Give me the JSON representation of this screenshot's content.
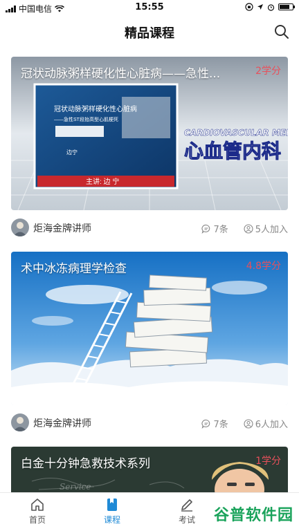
{
  "status": {
    "carrier": "中国电信",
    "time": "15:55"
  },
  "header": {
    "title": "精品课程"
  },
  "courses": [
    {
      "title": "冠状动脉粥样硬化性心脏病——急性...",
      "credit": "2学分",
      "teacher": "炬海金牌讲师",
      "comments": "7条",
      "joined": "5人加入",
      "slide": {
        "line1": "冠状动脉粥样硬化性心脏病",
        "line2": "——急性ST段抬高型心肌梗死",
        "presenter": "边宁",
        "lecturer": "主讲: 边 宁",
        "banner_en": "CARDIOVASCULAR MEDICINE",
        "banner_cn": "心血管内科"
      }
    },
    {
      "title": "术中冰冻病理学检查",
      "credit": "4.8学分",
      "teacher": "炬海金牌讲师",
      "comments": "7条",
      "joined": "6人加入"
    },
    {
      "title": "白金十分钟急救技术系列",
      "credit": "1学分",
      "chalk": "Service"
    }
  ],
  "tabs": [
    {
      "label": "首页"
    },
    {
      "label": "课程"
    },
    {
      "label": "考试"
    }
  ],
  "watermark": "谷普软件园",
  "colors": {
    "active_tab": "#1f8ad6",
    "credit": "#e8505b"
  },
  "battery_level": 0.8
}
